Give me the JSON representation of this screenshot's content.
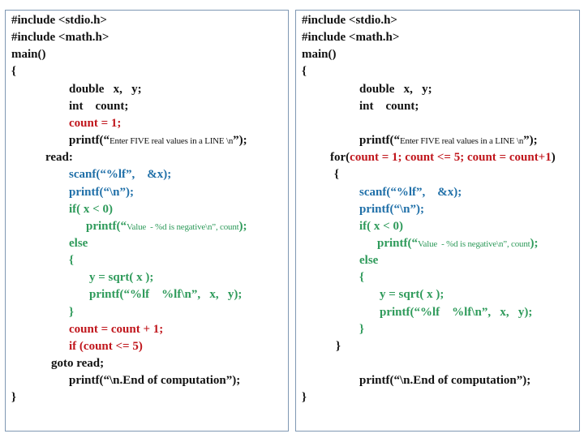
{
  "colors": {
    "black": "#111111",
    "red": "#c0161c",
    "blue": "#1f6fa8",
    "green": "#2e9a5a"
  },
  "left_code": [
    {
      "indent": 0,
      "row": 0,
      "segs": [
        {
          "t": "#include <stdio.h>",
          "c": "black"
        }
      ]
    },
    {
      "indent": 0,
      "row": 1,
      "segs": [
        {
          "t": "#include <math.h>",
          "c": "black"
        }
      ]
    },
    {
      "indent": 0,
      "row": 2,
      "segs": [
        {
          "t": "main()",
          "c": "black"
        }
      ]
    },
    {
      "indent": 0,
      "row": 3,
      "segs": [
        {
          "t": "{",
          "c": "black"
        }
      ]
    },
    {
      "indent": 71,
      "row": 4,
      "segs": [
        {
          "t": "double   x,   y;",
          "c": "black"
        }
      ]
    },
    {
      "indent": 71,
      "row": 5,
      "segs": [
        {
          "t": "int    count;",
          "c": "black"
        }
      ]
    },
    {
      "indent": 71,
      "row": 6,
      "segs": [
        {
          "t": "count = 1;",
          "c": "red"
        }
      ]
    },
    {
      "indent": 71,
      "row": 7,
      "segs": [
        {
          "t": "printf(“",
          "c": "black"
        },
        {
          "t": "Enter FIVE real values in a LINE \\n",
          "c": "black",
          "small": true
        },
        {
          "t": "”);",
          "c": "black"
        }
      ]
    },
    {
      "indent": 42,
      "row": 8,
      "segs": [
        {
          "t": "read:",
          "c": "black"
        }
      ]
    },
    {
      "indent": 71,
      "row": 9,
      "segs": [
        {
          "t": "scanf(“%lf”,    &x);",
          "c": "blue"
        }
      ]
    },
    {
      "indent": 71,
      "row": 10,
      "segs": [
        {
          "t": "printf(“\\n”);",
          "c": "blue"
        }
      ]
    },
    {
      "indent": 71,
      "row": 11,
      "segs": [
        {
          "t": "if( x < 0)",
          "c": "green"
        }
      ]
    },
    {
      "indent": 92,
      "row": 12,
      "segs": [
        {
          "t": "printf(“",
          "c": "green"
        },
        {
          "t": "Value  - %d is negative\\n”, count",
          "c": "green",
          "small": true
        },
        {
          "t": ");",
          "c": "green"
        }
      ]
    },
    {
      "indent": 71,
      "row": 13,
      "segs": [
        {
          "t": "else",
          "c": "green"
        }
      ]
    },
    {
      "indent": 71,
      "row": 14,
      "segs": [
        {
          "t": "{",
          "c": "green"
        }
      ]
    },
    {
      "indent": 96,
      "row": 15,
      "segs": [
        {
          "t": "y = sqrt( x );",
          "c": "green"
        }
      ]
    },
    {
      "indent": 96,
      "row": 16,
      "segs": [
        {
          "t": "printf(“%lf    %lf\\n”,   x,   y);",
          "c": "green"
        }
      ]
    },
    {
      "indent": 71,
      "row": 17,
      "segs": [
        {
          "t": "}",
          "c": "green"
        }
      ]
    },
    {
      "indent": 71,
      "row": 18,
      "segs": [
        {
          "t": "count = count + 1;",
          "c": "red"
        }
      ]
    },
    {
      "indent": 71,
      "row": 19,
      "segs": [
        {
          "t": "if (count <= 5)",
          "c": "red"
        }
      ]
    },
    {
      "indent": 49,
      "row": 20,
      "segs": [
        {
          "t": "goto read;",
          "c": "black"
        }
      ]
    },
    {
      "indent": 71,
      "row": 21,
      "segs": [
        {
          "t": "printf(“\\n.End of computation”);",
          "c": "black"
        }
      ]
    },
    {
      "indent": 0,
      "row": 22,
      "segs": [
        {
          "t": "}",
          "c": "black"
        }
      ]
    }
  ],
  "right_code": [
    {
      "indent": 0,
      "row": 0,
      "segs": [
        {
          "t": "#include <stdio.h>",
          "c": "black"
        }
      ]
    },
    {
      "indent": 0,
      "row": 1,
      "segs": [
        {
          "t": "#include <math.h>",
          "c": "black"
        }
      ]
    },
    {
      "indent": 0,
      "row": 2,
      "segs": [
        {
          "t": "main()",
          "c": "black"
        }
      ]
    },
    {
      "indent": 0,
      "row": 3,
      "segs": [
        {
          "t": "{",
          "c": "black"
        }
      ]
    },
    {
      "indent": 71,
      "row": 4,
      "segs": [
        {
          "t": "double   x,   y;",
          "c": "black"
        }
      ]
    },
    {
      "indent": 71,
      "row": 5,
      "segs": [
        {
          "t": "int    count;",
          "c": "black"
        }
      ]
    },
    {
      "indent": 71,
      "row": 7,
      "segs": [
        {
          "t": "printf(“",
          "c": "black"
        },
        {
          "t": "Enter FIVE real values in a LINE \\n",
          "c": "black",
          "small": true
        },
        {
          "t": "”);",
          "c": "black"
        }
      ]
    },
    {
      "indent": 35,
      "row": 8,
      "segs": [
        {
          "t": "for(",
          "c": "black"
        },
        {
          "t": "count = 1; count <= 5; count = count+1",
          "c": "red"
        },
        {
          "t": ")",
          "c": "black"
        }
      ]
    },
    {
      "indent": 40,
      "row": 9,
      "segs": [
        {
          "t": "{",
          "c": "black"
        }
      ]
    },
    {
      "indent": 71,
      "row": 10,
      "segs": [
        {
          "t": "scanf(“%lf”,    &x);",
          "c": "blue"
        }
      ]
    },
    {
      "indent": 71,
      "row": 11,
      "segs": [
        {
          "t": "printf(“\\n”);",
          "c": "blue"
        }
      ]
    },
    {
      "indent": 71,
      "row": 12,
      "segs": [
        {
          "t": "if( x < 0)",
          "c": "green"
        }
      ]
    },
    {
      "indent": 93,
      "row": 13,
      "segs": [
        {
          "t": "printf(“",
          "c": "green"
        },
        {
          "t": "Value  - %d is negative\\n”, count",
          "c": "green",
          "small": true
        },
        {
          "t": ");",
          "c": "green"
        }
      ]
    },
    {
      "indent": 71,
      "row": 14,
      "segs": [
        {
          "t": "else",
          "c": "green"
        }
      ]
    },
    {
      "indent": 71,
      "row": 15,
      "segs": [
        {
          "t": "{",
          "c": "green"
        }
      ]
    },
    {
      "indent": 96,
      "row": 16,
      "segs": [
        {
          "t": "y = sqrt( x );",
          "c": "green"
        }
      ]
    },
    {
      "indent": 96,
      "row": 17,
      "segs": [
        {
          "t": "printf(“%lf    %lf\\n”,   x,   y);",
          "c": "green"
        }
      ]
    },
    {
      "indent": 71,
      "row": 18,
      "segs": [
        {
          "t": "}",
          "c": "green"
        }
      ]
    },
    {
      "indent": 42,
      "row": 19,
      "segs": [
        {
          "t": "}",
          "c": "black"
        }
      ]
    },
    {
      "indent": 71,
      "row": 21,
      "segs": [
        {
          "t": "printf(“\\n.End of computation”);",
          "c": "black"
        }
      ]
    },
    {
      "indent": 0,
      "row": 22,
      "segs": [
        {
          "t": "}",
          "c": "black"
        }
      ]
    }
  ]
}
